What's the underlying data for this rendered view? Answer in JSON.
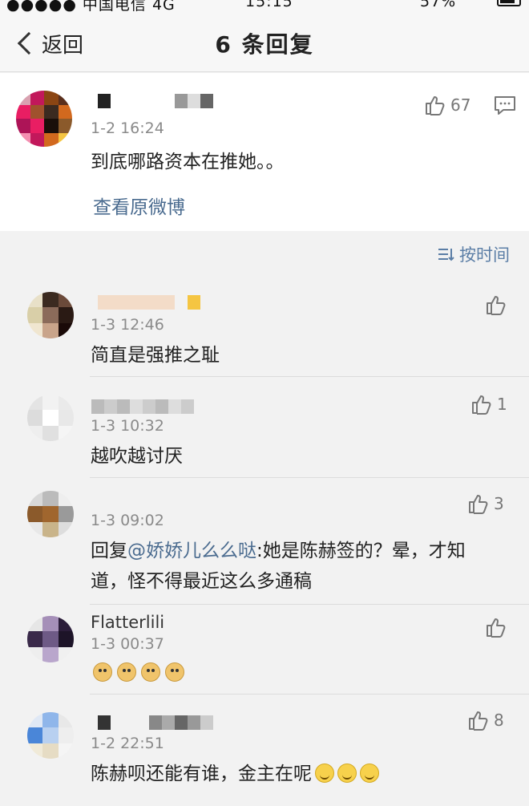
{
  "status_bar": {
    "carrier": "●●●●● 中国电信 4G",
    "time": "15:15",
    "battery": "57%"
  },
  "nav": {
    "back_label": "返回",
    "title": "6 条回复"
  },
  "original": {
    "time": "1-2 16:24",
    "likes": "67",
    "content": "到底哪路资本在推她。。",
    "view_link": "查看原微博"
  },
  "sort": {
    "label": "按时间"
  },
  "replies": [
    {
      "username": "",
      "time": "1-3 12:46",
      "likes": "",
      "content": "简直是强推之耻"
    },
    {
      "username": "",
      "time": "1-3 10:32",
      "likes": "1",
      "content": "越吹越讨厌"
    },
    {
      "username": "",
      "time": "1-3 09:02",
      "likes": "3",
      "content_prefix": "回复",
      "mention": "@娇娇儿么么哒",
      "content": ":她是陈赫签的？晕，才知",
      "content_line2": "道，怪不得最近这么多通稿"
    },
    {
      "username": "Flatterlili",
      "time": "1-3 00:37",
      "likes": "",
      "content": ""
    },
    {
      "username": "",
      "time": "1-2 22:51",
      "likes": "8",
      "content": "陈赫呗还能有谁，金主在呢"
    }
  ],
  "colors": {
    "link": "#4a6b8f",
    "sort": "#5b7ea6",
    "time": "#8a8a8a"
  }
}
